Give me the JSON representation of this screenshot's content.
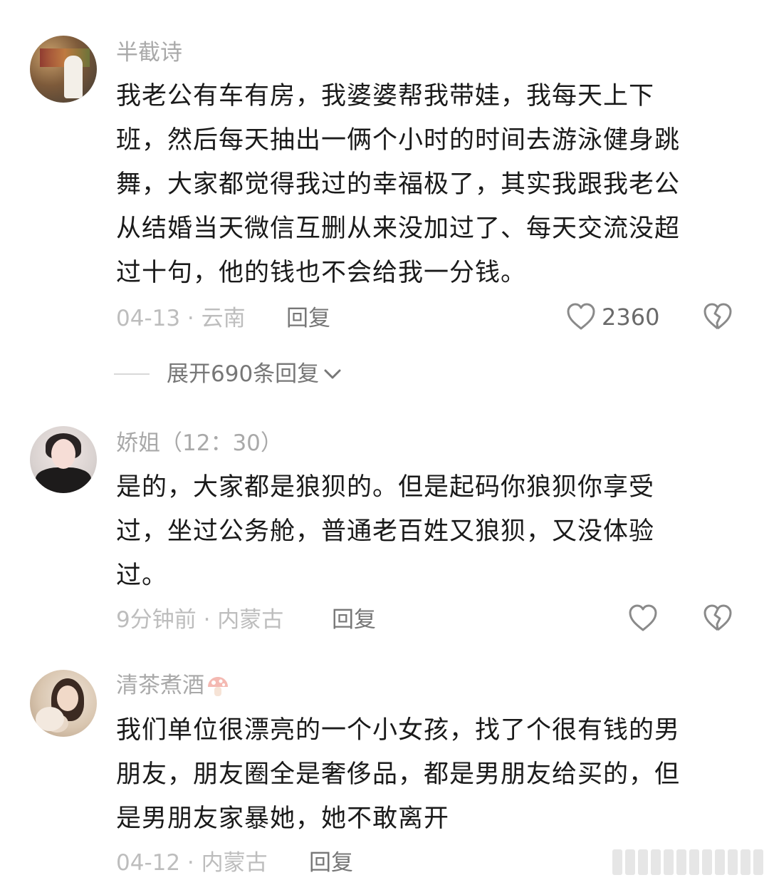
{
  "comments": [
    {
      "username": "半截诗",
      "lines": [
        "我老公有车有房，我婆婆帮我带娃，我每天上下",
        "班，然后每天抽出一俩个小时的时间去游泳健身跳",
        "舞，大家都觉得我过的幸福极了，其实我跟我老公",
        "从结婚当天微信互删从来没加过了、每天交流没超",
        "过十句，他的钱也不会给我一分钱。"
      ],
      "meta": "04-13 · 云南",
      "reply": "回复",
      "likes": "2360",
      "expand": "展开690条回复"
    },
    {
      "username": "娇姐（12：30）",
      "lines": [
        "是的，大家都是狼狈的。但是起码你狼狈你享受",
        "过，坐过公务舱，普通老百姓又狼狈，又没体验",
        "过。"
      ],
      "meta": "9分钟前 · 内蒙古",
      "reply": "回复"
    },
    {
      "username": "清茶煮酒",
      "lines": [
        "我们单位很漂亮的一个小女孩，找了个很有钱的男",
        "朋友，朋友圈全是奢侈品，都是男朋友给买的，但",
        "是男朋友家暴她，她不敢离开"
      ],
      "meta": "04-12 · 内蒙古",
      "reply": "回复"
    }
  ],
  "icons": {
    "like": "heart-outline-icon",
    "dislike": "broken-heart-icon",
    "expand": "chevron-down-icon",
    "emoji": "mushroom-icon"
  },
  "colors": {
    "text": "#1a1a1a",
    "username": "#a9a9a9",
    "meta": "#bdbdbd",
    "reply": "#777777",
    "icon": "#8a8a8a"
  }
}
